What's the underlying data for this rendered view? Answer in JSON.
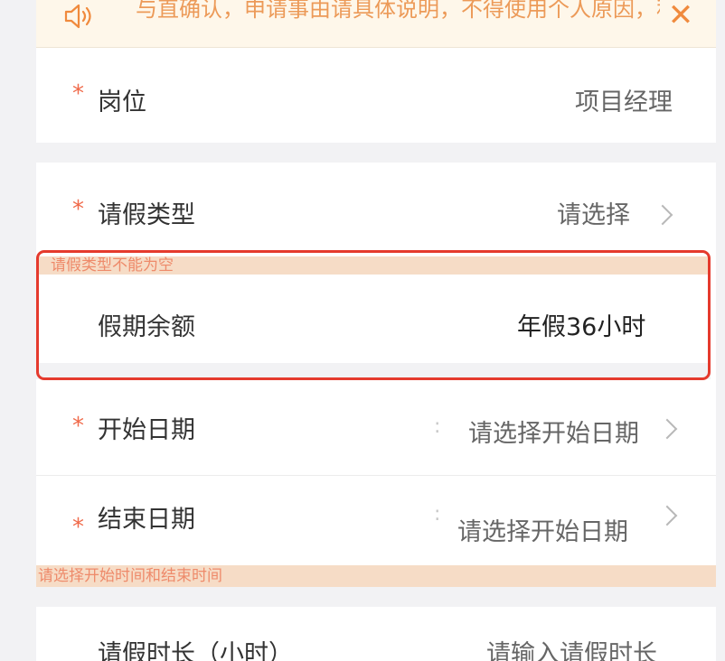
{
  "notice": {
    "text": "与直确认，申请事由请具体说明，不得使用个人原因，私",
    "speaker_icon": "speaker-icon",
    "close_icon": "close-icon",
    "accent": "#f08a3d"
  },
  "form": {
    "position": {
      "label": "岗位",
      "value": "项目经理"
    },
    "leave_type": {
      "label": "请假类型",
      "placeholder": "请选择"
    },
    "leave_type_error": "请假类型不能为空",
    "leave_balance": {
      "label": "假期余额",
      "value": "年假36小时"
    },
    "start_date": {
      "label": "开始日期",
      "placeholder": "请选择开始日期"
    },
    "end_date": {
      "label": "结束日期",
      "placeholder": "请选择开始日期"
    },
    "date_error": "请选择开始时间和结束时间",
    "duration": {
      "label": "请假时长（小时）",
      "placeholder": "请输入请假时长"
    },
    "required_mark": "*",
    "colon_glyph": ":"
  },
  "colors": {
    "required": "#f06a4a",
    "error_bg": "#f6dcc6",
    "highlight_border": "#e53a2d"
  }
}
